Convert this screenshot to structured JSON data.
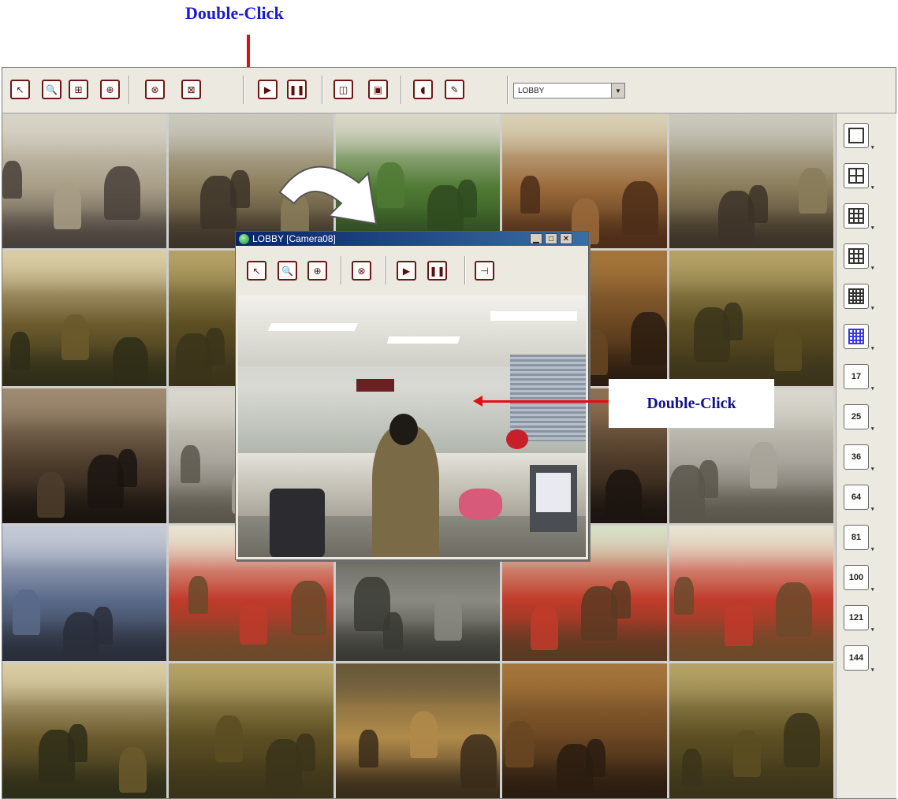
{
  "annotations": {
    "top_label": "Double-Click",
    "callout_label": "Double-Click"
  },
  "toolbar": {
    "buttons": [
      {
        "name": "select-tool-button",
        "icon": "cursor-icon",
        "glyph": "↖"
      },
      {
        "name": "zoom-tool-button",
        "icon": "magnifier-icon",
        "glyph": "🔍"
      },
      {
        "name": "area-zoom-button",
        "icon": "area-zoom-icon",
        "glyph": "⊞"
      },
      {
        "name": "ptz-button",
        "icon": "ptz-icon",
        "glyph": "⊕"
      },
      {
        "name": "close-camera-button",
        "icon": "close-camera-icon",
        "glyph": "⊗"
      },
      {
        "name": "close-all-button",
        "icon": "close-all-icon",
        "glyph": "⊠"
      },
      {
        "name": "play-button",
        "icon": "play-icon",
        "glyph": "▶"
      },
      {
        "name": "pause-button",
        "icon": "pause-icon",
        "glyph": "❚❚"
      },
      {
        "name": "sequence-button",
        "icon": "sequence-icon",
        "glyph": "◫"
      },
      {
        "name": "fullscreen-button",
        "icon": "fullscreen-icon",
        "glyph": "▣"
      },
      {
        "name": "audio-button",
        "icon": "speaker-icon",
        "glyph": "◖"
      },
      {
        "name": "microphone-button",
        "icon": "microphone-icon",
        "glyph": "✎"
      }
    ],
    "channel_select": {
      "value": "LOBBY"
    }
  },
  "layout_panel": {
    "buttons": [
      {
        "name": "layout-1",
        "icon": "single-view-icon",
        "label": ""
      },
      {
        "name": "layout-4",
        "icon": "quad-view-icon",
        "label": ""
      },
      {
        "name": "layout-6",
        "icon": "six-view-icon",
        "label": ""
      },
      {
        "name": "layout-9",
        "icon": "nine-view-icon",
        "label": ""
      },
      {
        "name": "layout-13",
        "icon": "thirteen-view-icon",
        "label": ""
      },
      {
        "name": "layout-16",
        "icon": "sixteen-view-icon",
        "label": ""
      },
      {
        "name": "layout-17",
        "icon": "",
        "label": "17"
      },
      {
        "name": "layout-25",
        "icon": "",
        "label": "25"
      },
      {
        "name": "layout-36",
        "icon": "",
        "label": "36"
      },
      {
        "name": "layout-64",
        "icon": "",
        "label": "64"
      },
      {
        "name": "layout-81",
        "icon": "",
        "label": "81"
      },
      {
        "name": "layout-100",
        "icon": "",
        "label": "100"
      },
      {
        "name": "layout-121",
        "icon": "",
        "label": "121"
      },
      {
        "name": "layout-144",
        "icon": "",
        "label": "144"
      }
    ]
  },
  "popup": {
    "title": "LOBBY [Camera08]",
    "buttons": [
      {
        "name": "popup-select-button",
        "icon": "cursor-icon",
        "glyph": "↖"
      },
      {
        "name": "popup-zoom-button",
        "icon": "magnifier-icon",
        "glyph": "🔍"
      },
      {
        "name": "popup-ptz-button",
        "icon": "ptz-icon",
        "glyph": "⊕"
      },
      {
        "name": "popup-close-camera-button",
        "icon": "close-camera-icon",
        "glyph": "⊗"
      },
      {
        "name": "popup-play-button",
        "icon": "play-icon",
        "glyph": "▶"
      },
      {
        "name": "popup-pause-button",
        "icon": "pause-icon",
        "glyph": "❚❚"
      },
      {
        "name": "popup-snapshot-button",
        "icon": "snapshot-icon",
        "glyph": "⊣"
      }
    ]
  },
  "camera_tiles": [
    {
      "scene": "bank-lobby",
      "palette": [
        "#d6d3c6",
        "#a89d86",
        "#48403a"
      ]
    },
    {
      "scene": "bank-counter",
      "palette": [
        "#c9c8bc",
        "#8a7c5a",
        "#3c3328"
      ]
    },
    {
      "scene": "produce-aisle",
      "palette": [
        "#d9d7c7",
        "#4f7a34",
        "#2e4a1e"
      ]
    },
    {
      "scene": "deli-shelves",
      "palette": [
        "#d8cfb4",
        "#9a6a3a",
        "#4c2d18"
      ]
    },
    {
      "scene": "bank-counter",
      "palette": [
        "#c9c8bc",
        "#8a7c5a",
        "#3c3328"
      ]
    },
    {
      "scene": "hotel-lounge",
      "palette": [
        "#d9cca3",
        "#6b5a2c",
        "#2e2d18"
      ]
    },
    {
      "scene": "hotel-hall",
      "palette": [
        "#b2a064",
        "#5c4e22",
        "#3b341a"
      ]
    },
    {
      "scene": "hidden",
      "palette": [
        "#888888",
        "#666666",
        "#444444"
      ]
    },
    {
      "scene": "banquet-hall",
      "palette": [
        "#a4743a",
        "#6a4622",
        "#2a1c10"
      ]
    },
    {
      "scene": "hotel-hall",
      "palette": [
        "#b2a064",
        "#5c4e22",
        "#3b341a"
      ]
    },
    {
      "scene": "party",
      "palette": [
        "#9d8a70",
        "#4e3d2c",
        "#1a1410"
      ]
    },
    {
      "scene": "kitchen",
      "palette": [
        "#d8d6cc",
        "#a7a39a",
        "#5a564c"
      ]
    },
    {
      "scene": "hidden",
      "palette": [
        "#888888",
        "#666666",
        "#444444"
      ]
    },
    {
      "scene": "party",
      "palette": [
        "#8d6f52",
        "#4c3a28",
        "#1c1410"
      ]
    },
    {
      "scene": "kitchen",
      "palette": [
        "#d8d6cc",
        "#a7a39a",
        "#5a564c"
      ]
    },
    {
      "scene": "book-store",
      "palette": [
        "#c5c9d6",
        "#5a6a8a",
        "#2a2e3a"
      ]
    },
    {
      "scene": "fast-food",
      "palette": [
        "#e8e2d0",
        "#c03a2a",
        "#6a4a2a"
      ]
    },
    {
      "scene": "parking-lot",
      "palette": [
        "#5a5a52",
        "#8a8a82",
        "#3a3a34"
      ]
    },
    {
      "scene": "market-stall",
      "palette": [
        "#d7dfc5",
        "#c23b2a",
        "#5a3a22"
      ]
    },
    {
      "scene": "fast-food",
      "palette": [
        "#e8e2d0",
        "#c03a2a",
        "#6a4a2a"
      ]
    },
    {
      "scene": "hotel-lounge",
      "palette": [
        "#d9cca3",
        "#6b5a2c",
        "#2e2d18"
      ]
    },
    {
      "scene": "hotel-hall",
      "palette": [
        "#b2a064",
        "#5c4e22",
        "#3b341a"
      ]
    },
    {
      "scene": "hotel-lobby-night",
      "palette": [
        "#6a5a3a",
        "#b08a4a",
        "#3a2c1a"
      ]
    },
    {
      "scene": "banquet-hall",
      "palette": [
        "#a4743a",
        "#6a4622",
        "#2a1c10"
      ]
    },
    {
      "scene": "hotel-hall",
      "palette": [
        "#b2a064",
        "#5c4e22",
        "#3b341a"
      ]
    }
  ]
}
